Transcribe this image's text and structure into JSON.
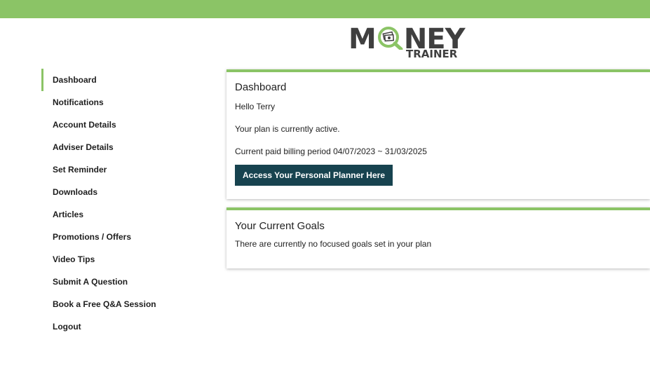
{
  "header": {
    "logo_main_prefix": "M",
    "logo_main_suffix": "NEY",
    "logo_sub": "TRAINER",
    "bar_color": "#8bc466"
  },
  "sidebar": {
    "active_color": "#8bc466",
    "items": [
      {
        "label": "Dashboard",
        "active": true
      },
      {
        "label": "Notifications"
      },
      {
        "label": "Account Details"
      },
      {
        "label": "Adviser Details"
      },
      {
        "label": "Set Reminder"
      },
      {
        "label": "Downloads"
      },
      {
        "label": "Articles"
      },
      {
        "label": "Promotions / Offers"
      },
      {
        "label": "Video Tips"
      },
      {
        "label": "Submit A Question"
      },
      {
        "label": "Book a Free Q&A Session"
      },
      {
        "label": "Logout"
      }
    ]
  },
  "dashboard": {
    "title": "Dashboard",
    "greeting": "Hello Terry",
    "status": "Your plan is currently active.",
    "billing": "Current paid billing period 04/07/2023 ~ 31/03/2025",
    "planner_button": "Access Your Personal Planner Here",
    "button_color": "#17434f"
  },
  "goals": {
    "title": "Your Current Goals",
    "message": "There are currently no focused goals set in your plan"
  }
}
